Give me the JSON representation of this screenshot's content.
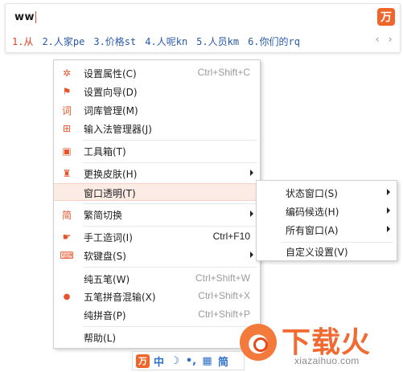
{
  "composition": {
    "text": "ww"
  },
  "logo_glyph": "万",
  "candidates": [
    "1.从",
    "2.人家pe",
    "3.价格st",
    "4.人呢kn",
    "5.人员km",
    "6.你们的rq"
  ],
  "nav": {
    "prev": "‹",
    "next": "›"
  },
  "menu": {
    "items": [
      {
        "label": "设置属性(C)",
        "shortcut": "Ctrl+Shift+C",
        "icon": "gear-icon",
        "glyph": "✲"
      },
      {
        "label": "设置向导(D)",
        "shortcut": "",
        "icon": "flag-icon",
        "glyph": "⚑"
      },
      {
        "label": "词库管理(M)",
        "shortcut": "",
        "icon": "dictionary-icon",
        "glyph": "词"
      },
      {
        "label": "输入法管理器(J)",
        "shortcut": "",
        "icon": "manager-icon",
        "glyph": "⊞"
      },
      {
        "label": "工具箱(T)",
        "shortcut": "",
        "icon": "toolbox-icon",
        "glyph": "▣"
      },
      {
        "label": "更换皮肤(H)",
        "shortcut": "",
        "icon": "shirt-icon",
        "glyph": "♜"
      },
      {
        "label": "窗口透明(T)",
        "shortcut": "",
        "icon": "",
        "glyph": ""
      },
      {
        "label": "繁简切换",
        "shortcut": "",
        "icon": "traditional-simplified-icon",
        "glyph": "简"
      },
      {
        "label": "手工造词(I)",
        "shortcut": "Ctrl+F10",
        "icon": "hand-icon",
        "glyph": "☛"
      },
      {
        "label": "软键盘(S)",
        "shortcut": "",
        "icon": "soft-keyboard-icon",
        "glyph": "⌨"
      },
      {
        "label": "纯五笔(W)",
        "shortcut": "Ctrl+Shift+W",
        "icon": "",
        "glyph": ""
      },
      {
        "label": "五笔拼音混输(X)",
        "shortcut": "Ctrl+Shift+X",
        "icon": "selected-dot-icon",
        "glyph": "●"
      },
      {
        "label": "纯拼音(P)",
        "shortcut": "Ctrl+Shift+P",
        "icon": "",
        "glyph": ""
      },
      {
        "label": "帮助(L)",
        "shortcut": "",
        "icon": "",
        "glyph": ""
      }
    ]
  },
  "submenu": {
    "items": [
      {
        "label": "状态窗口(S)"
      },
      {
        "label": "编码候选(H)"
      },
      {
        "label": "所有窗口(A)"
      },
      {
        "label": "自定义设置(V)"
      }
    ]
  },
  "statusbar": {
    "logo": "万",
    "mode": "中",
    "moon": "☽",
    "punct": "•,",
    "keyboard": "▦",
    "charset": "简"
  },
  "watermark": {
    "title": "下载火",
    "url": "xiazaihuo.com"
  },
  "colors": {
    "accent": "#f0662a",
    "candidate": "#2b5aa8",
    "first_candidate": "#e0401e"
  }
}
